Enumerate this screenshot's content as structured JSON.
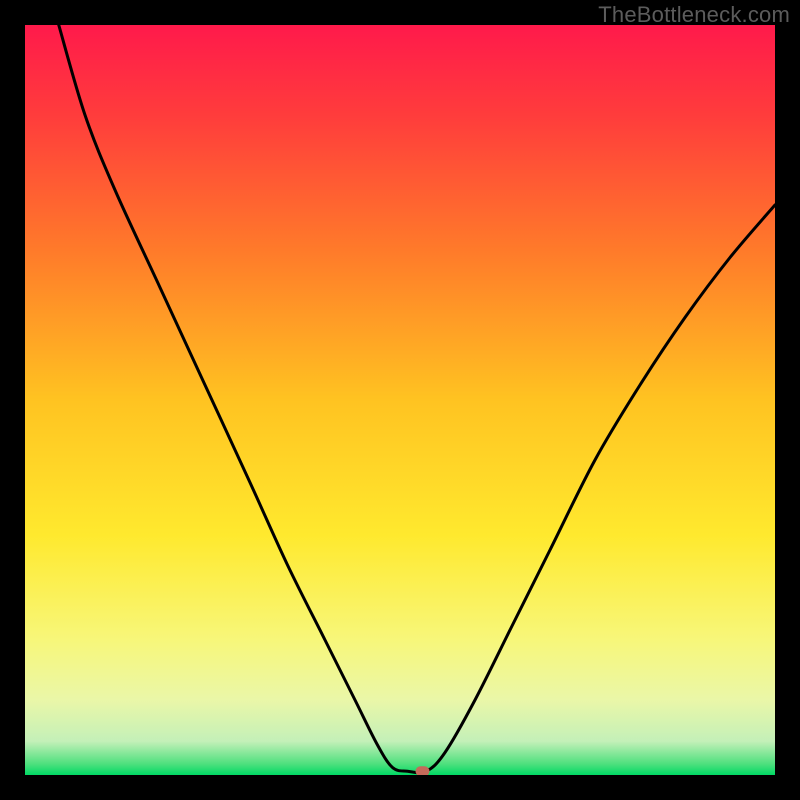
{
  "watermark": "TheBottleneck.com",
  "chart_data": {
    "type": "line",
    "title": "",
    "xlabel": "",
    "ylabel": "",
    "xlim": [
      0,
      100
    ],
    "ylim": [
      0,
      100
    ],
    "background_gradient": [
      {
        "stop": 0.0,
        "color": "#ff1a4b"
      },
      {
        "stop": 0.12,
        "color": "#ff3c3c"
      },
      {
        "stop": 0.3,
        "color": "#ff7a2a"
      },
      {
        "stop": 0.5,
        "color": "#ffc321"
      },
      {
        "stop": 0.68,
        "color": "#ffe92e"
      },
      {
        "stop": 0.82,
        "color": "#f7f77a"
      },
      {
        "stop": 0.9,
        "color": "#eaf7a8"
      },
      {
        "stop": 0.955,
        "color": "#c4f0b8"
      },
      {
        "stop": 0.985,
        "color": "#4fe07e"
      },
      {
        "stop": 1.0,
        "color": "#00d964"
      }
    ],
    "series": [
      {
        "name": "bottleneck-curve",
        "color": "#000000",
        "points": [
          {
            "x": 4.5,
            "y": 100.0
          },
          {
            "x": 8.0,
            "y": 88.0
          },
          {
            "x": 12.0,
            "y": 78.0
          },
          {
            "x": 18.0,
            "y": 65.0
          },
          {
            "x": 24.0,
            "y": 52.0
          },
          {
            "x": 30.0,
            "y": 39.0
          },
          {
            "x": 35.0,
            "y": 28.0
          },
          {
            "x": 40.0,
            "y": 18.0
          },
          {
            "x": 44.0,
            "y": 10.0
          },
          {
            "x": 47.0,
            "y": 4.0
          },
          {
            "x": 49.0,
            "y": 1.0
          },
          {
            "x": 51.0,
            "y": 0.5
          },
          {
            "x": 53.5,
            "y": 0.5
          },
          {
            "x": 56.0,
            "y": 3.0
          },
          {
            "x": 60.0,
            "y": 10.0
          },
          {
            "x": 65.0,
            "y": 20.0
          },
          {
            "x": 70.0,
            "y": 30.0
          },
          {
            "x": 76.0,
            "y": 42.0
          },
          {
            "x": 82.0,
            "y": 52.0
          },
          {
            "x": 88.0,
            "y": 61.0
          },
          {
            "x": 94.0,
            "y": 69.0
          },
          {
            "x": 100.0,
            "y": 76.0
          }
        ]
      }
    ],
    "marker": {
      "x": 53.0,
      "y": 0.5,
      "color": "#c46a5a"
    }
  }
}
